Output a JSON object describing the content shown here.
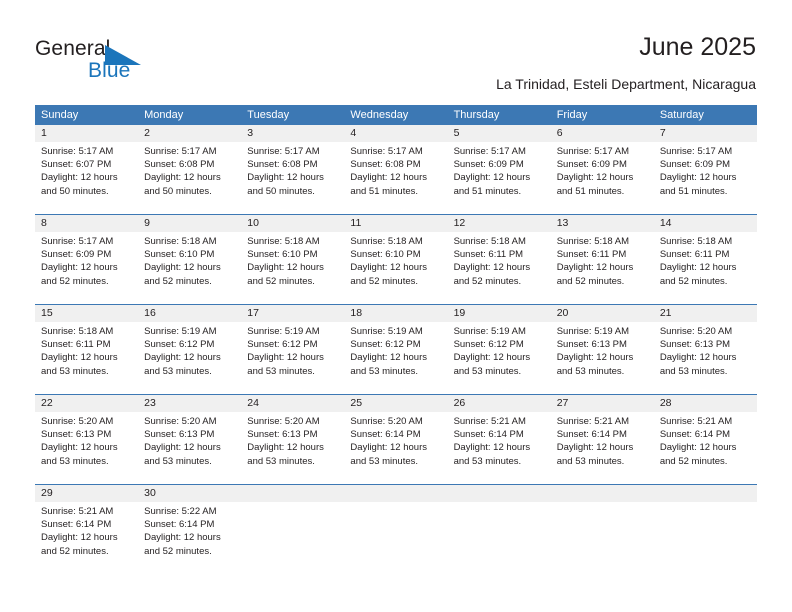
{
  "brand": {
    "name_part1": "General",
    "name_part2": "Blue",
    "accent_color": "#1b75bb",
    "triangle_icon": "triangle-icon"
  },
  "header": {
    "title": "June 2025",
    "location": "La Trinidad, Esteli Department, Nicaragua"
  },
  "calendar": {
    "header_bg": "#3c78b4",
    "daynum_bg": "#f0f0f0",
    "weekdays": [
      "Sunday",
      "Monday",
      "Tuesday",
      "Wednesday",
      "Thursday",
      "Friday",
      "Saturday"
    ],
    "weeks": [
      [
        {
          "day": "1",
          "sunrise": "Sunrise: 5:17 AM",
          "sunset": "Sunset: 6:07 PM",
          "daylight1": "Daylight: 12 hours",
          "daylight2": "and 50 minutes."
        },
        {
          "day": "2",
          "sunrise": "Sunrise: 5:17 AM",
          "sunset": "Sunset: 6:08 PM",
          "daylight1": "Daylight: 12 hours",
          "daylight2": "and 50 minutes."
        },
        {
          "day": "3",
          "sunrise": "Sunrise: 5:17 AM",
          "sunset": "Sunset: 6:08 PM",
          "daylight1": "Daylight: 12 hours",
          "daylight2": "and 50 minutes."
        },
        {
          "day": "4",
          "sunrise": "Sunrise: 5:17 AM",
          "sunset": "Sunset: 6:08 PM",
          "daylight1": "Daylight: 12 hours",
          "daylight2": "and 51 minutes."
        },
        {
          "day": "5",
          "sunrise": "Sunrise: 5:17 AM",
          "sunset": "Sunset: 6:09 PM",
          "daylight1": "Daylight: 12 hours",
          "daylight2": "and 51 minutes."
        },
        {
          "day": "6",
          "sunrise": "Sunrise: 5:17 AM",
          "sunset": "Sunset: 6:09 PM",
          "daylight1": "Daylight: 12 hours",
          "daylight2": "and 51 minutes."
        },
        {
          "day": "7",
          "sunrise": "Sunrise: 5:17 AM",
          "sunset": "Sunset: 6:09 PM",
          "daylight1": "Daylight: 12 hours",
          "daylight2": "and 51 minutes."
        }
      ],
      [
        {
          "day": "8",
          "sunrise": "Sunrise: 5:17 AM",
          "sunset": "Sunset: 6:09 PM",
          "daylight1": "Daylight: 12 hours",
          "daylight2": "and 52 minutes."
        },
        {
          "day": "9",
          "sunrise": "Sunrise: 5:18 AM",
          "sunset": "Sunset: 6:10 PM",
          "daylight1": "Daylight: 12 hours",
          "daylight2": "and 52 minutes."
        },
        {
          "day": "10",
          "sunrise": "Sunrise: 5:18 AM",
          "sunset": "Sunset: 6:10 PM",
          "daylight1": "Daylight: 12 hours",
          "daylight2": "and 52 minutes."
        },
        {
          "day": "11",
          "sunrise": "Sunrise: 5:18 AM",
          "sunset": "Sunset: 6:10 PM",
          "daylight1": "Daylight: 12 hours",
          "daylight2": "and 52 minutes."
        },
        {
          "day": "12",
          "sunrise": "Sunrise: 5:18 AM",
          "sunset": "Sunset: 6:11 PM",
          "daylight1": "Daylight: 12 hours",
          "daylight2": "and 52 minutes."
        },
        {
          "day": "13",
          "sunrise": "Sunrise: 5:18 AM",
          "sunset": "Sunset: 6:11 PM",
          "daylight1": "Daylight: 12 hours",
          "daylight2": "and 52 minutes."
        },
        {
          "day": "14",
          "sunrise": "Sunrise: 5:18 AM",
          "sunset": "Sunset: 6:11 PM",
          "daylight1": "Daylight: 12 hours",
          "daylight2": "and 52 minutes."
        }
      ],
      [
        {
          "day": "15",
          "sunrise": "Sunrise: 5:18 AM",
          "sunset": "Sunset: 6:11 PM",
          "daylight1": "Daylight: 12 hours",
          "daylight2": "and 53 minutes."
        },
        {
          "day": "16",
          "sunrise": "Sunrise: 5:19 AM",
          "sunset": "Sunset: 6:12 PM",
          "daylight1": "Daylight: 12 hours",
          "daylight2": "and 53 minutes."
        },
        {
          "day": "17",
          "sunrise": "Sunrise: 5:19 AM",
          "sunset": "Sunset: 6:12 PM",
          "daylight1": "Daylight: 12 hours",
          "daylight2": "and 53 minutes."
        },
        {
          "day": "18",
          "sunrise": "Sunrise: 5:19 AM",
          "sunset": "Sunset: 6:12 PM",
          "daylight1": "Daylight: 12 hours",
          "daylight2": "and 53 minutes."
        },
        {
          "day": "19",
          "sunrise": "Sunrise: 5:19 AM",
          "sunset": "Sunset: 6:12 PM",
          "daylight1": "Daylight: 12 hours",
          "daylight2": "and 53 minutes."
        },
        {
          "day": "20",
          "sunrise": "Sunrise: 5:19 AM",
          "sunset": "Sunset: 6:13 PM",
          "daylight1": "Daylight: 12 hours",
          "daylight2": "and 53 minutes."
        },
        {
          "day": "21",
          "sunrise": "Sunrise: 5:20 AM",
          "sunset": "Sunset: 6:13 PM",
          "daylight1": "Daylight: 12 hours",
          "daylight2": "and 53 minutes."
        }
      ],
      [
        {
          "day": "22",
          "sunrise": "Sunrise: 5:20 AM",
          "sunset": "Sunset: 6:13 PM",
          "daylight1": "Daylight: 12 hours",
          "daylight2": "and 53 minutes."
        },
        {
          "day": "23",
          "sunrise": "Sunrise: 5:20 AM",
          "sunset": "Sunset: 6:13 PM",
          "daylight1": "Daylight: 12 hours",
          "daylight2": "and 53 minutes."
        },
        {
          "day": "24",
          "sunrise": "Sunrise: 5:20 AM",
          "sunset": "Sunset: 6:13 PM",
          "daylight1": "Daylight: 12 hours",
          "daylight2": "and 53 minutes."
        },
        {
          "day": "25",
          "sunrise": "Sunrise: 5:20 AM",
          "sunset": "Sunset: 6:14 PM",
          "daylight1": "Daylight: 12 hours",
          "daylight2": "and 53 minutes."
        },
        {
          "day": "26",
          "sunrise": "Sunrise: 5:21 AM",
          "sunset": "Sunset: 6:14 PM",
          "daylight1": "Daylight: 12 hours",
          "daylight2": "and 53 minutes."
        },
        {
          "day": "27",
          "sunrise": "Sunrise: 5:21 AM",
          "sunset": "Sunset: 6:14 PM",
          "daylight1": "Daylight: 12 hours",
          "daylight2": "and 53 minutes."
        },
        {
          "day": "28",
          "sunrise": "Sunrise: 5:21 AM",
          "sunset": "Sunset: 6:14 PM",
          "daylight1": "Daylight: 12 hours",
          "daylight2": "and 52 minutes."
        }
      ],
      [
        {
          "day": "29",
          "sunrise": "Sunrise: 5:21 AM",
          "sunset": "Sunset: 6:14 PM",
          "daylight1": "Daylight: 12 hours",
          "daylight2": "and 52 minutes."
        },
        {
          "day": "30",
          "sunrise": "Sunrise: 5:22 AM",
          "sunset": "Sunset: 6:14 PM",
          "daylight1": "Daylight: 12 hours",
          "daylight2": "and 52 minutes."
        },
        {
          "day": "",
          "sunrise": "",
          "sunset": "",
          "daylight1": "",
          "daylight2": ""
        },
        {
          "day": "",
          "sunrise": "",
          "sunset": "",
          "daylight1": "",
          "daylight2": ""
        },
        {
          "day": "",
          "sunrise": "",
          "sunset": "",
          "daylight1": "",
          "daylight2": ""
        },
        {
          "day": "",
          "sunrise": "",
          "sunset": "",
          "daylight1": "",
          "daylight2": ""
        },
        {
          "day": "",
          "sunrise": "",
          "sunset": "",
          "daylight1": "",
          "daylight2": ""
        }
      ]
    ]
  }
}
